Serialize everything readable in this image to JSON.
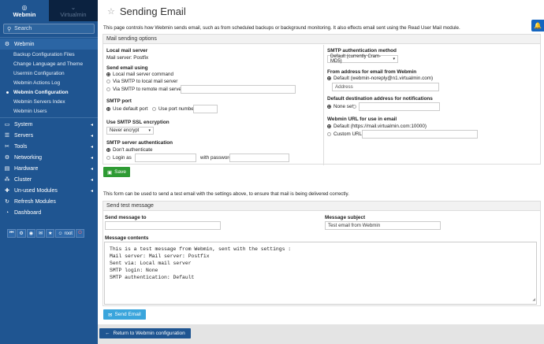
{
  "sidebar": {
    "tabs": [
      {
        "label": "Webmin",
        "icon": "webmin-logo-icon"
      },
      {
        "label": "Virtualmin",
        "icon": "chevron-down-icon"
      }
    ],
    "search_label": "Search",
    "sections": [
      {
        "label": "Webmin",
        "icon": "gear-icon"
      },
      {
        "label": "System",
        "icon": "monitor-icon"
      },
      {
        "label": "Servers",
        "icon": "server-icon"
      },
      {
        "label": "Tools",
        "icon": "wrench-icon"
      },
      {
        "label": "Networking",
        "icon": "network-icon"
      },
      {
        "label": "Hardware",
        "icon": "hdd-icon"
      },
      {
        "label": "Cluster",
        "icon": "cluster-icon"
      },
      {
        "label": "Un-used Modules",
        "icon": "puzzle-icon"
      },
      {
        "label": "Refresh Modules",
        "icon": "refresh-icon"
      },
      {
        "label": "Dashboard",
        "icon": "dashboard-icon"
      }
    ],
    "webmin_items": [
      "Backup Configuration Files",
      "Change Language and Theme",
      "Usermin Configuration",
      "Webmin Actions Log",
      "Webmin Configuration",
      "Webmin Servers Index",
      "Webmin Users"
    ],
    "footer_user": "root"
  },
  "page": {
    "title": "Sending Email",
    "description": "This page controls how Webmin sends email, such as from scheduled backups or background monitoring. It also effects email sent using the Read User Mail module."
  },
  "mail_options": {
    "header": "Mail sending options",
    "local_server_label": "Local mail server",
    "local_server_value": "Mail server: Postfix",
    "send_using_label": "Send email using",
    "send_using_options": [
      "Local mail server command",
      "Via SMTP to local mail server",
      "Via SMTP to remote mail server"
    ],
    "smtp_port_label": "SMTP port",
    "smtp_port_options": [
      "Use default port",
      "Use port number"
    ],
    "ssl_label": "Use SMTP SSL encryption",
    "ssl_value": "Never encrypt",
    "smtp_auth_label": "SMTP server authentication",
    "smtp_auth_options": [
      "Don't authenticate",
      "Login as"
    ],
    "with_password": "with password",
    "auth_method_label": "SMTP authentication method",
    "auth_method_value": "Default (currently Cram-MD5)",
    "from_label": "From address for email from Webmin",
    "from_default": "Default (webmin-noreply@n1.virtualmin.com)",
    "from_placeholder": "Address",
    "dest_label": "Default destination address for notifications",
    "dest_option": "None set",
    "url_label": "Webmin URL for use in email",
    "url_default": "Default (https://mail.virtualmin.com:10000)",
    "url_custom": "Custom URL",
    "save_label": "Save"
  },
  "test_section": {
    "description": "This form can be used to send a test email with the settings above, to ensure that mail is being delivered correctly.",
    "header": "Send test message",
    "to_label": "Send message to",
    "to_value": "",
    "subject_label": "Message subject",
    "subject_value": "Test email from Webmin",
    "contents_label": "Message contents",
    "contents_lines": [
      "This is a test message from Webmin, sent with the settings :",
      "",
      "Mail server: Mail server: Postfix",
      "Sent via: Local mail server",
      "SMTP login: None",
      "SMTP authentication: Default"
    ],
    "send_label": "Send Email"
  },
  "return_label": "Return to Webmin configuration"
}
